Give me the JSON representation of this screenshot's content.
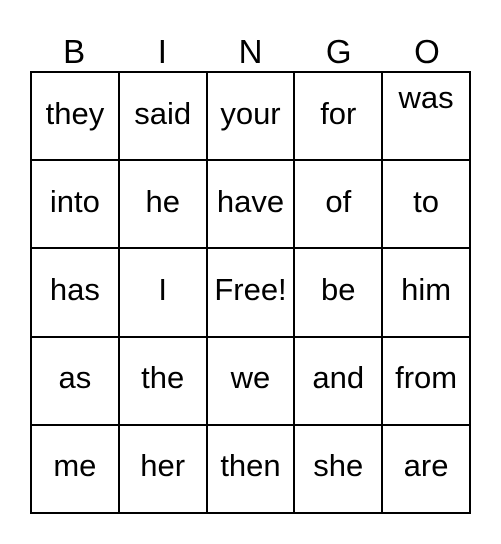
{
  "card": {
    "title": "BINGO",
    "headers": [
      "B",
      "I",
      "N",
      "G",
      "O"
    ],
    "free_space_label": "Free!",
    "colors": {
      "text": "#000000",
      "border": "#000000",
      "background": "#ffffff"
    },
    "grid": [
      [
        {
          "text": "they"
        },
        {
          "text": "said"
        },
        {
          "text": "your"
        },
        {
          "text": "for"
        },
        {
          "text": "was"
        }
      ],
      [
        {
          "text": "into"
        },
        {
          "text": "he"
        },
        {
          "text": "have"
        },
        {
          "text": "of"
        },
        {
          "text": "to"
        }
      ],
      [
        {
          "text": "has"
        },
        {
          "text": "I"
        },
        {
          "text": "Free!"
        },
        {
          "text": "be"
        },
        {
          "text": "him"
        }
      ],
      [
        {
          "text": "as"
        },
        {
          "text": "the"
        },
        {
          "text": "we"
        },
        {
          "text": "and"
        },
        {
          "text": "from"
        }
      ],
      [
        {
          "text": "me"
        },
        {
          "text": "her"
        },
        {
          "text": "then"
        },
        {
          "text": "she"
        },
        {
          "text": "are"
        }
      ]
    ]
  }
}
